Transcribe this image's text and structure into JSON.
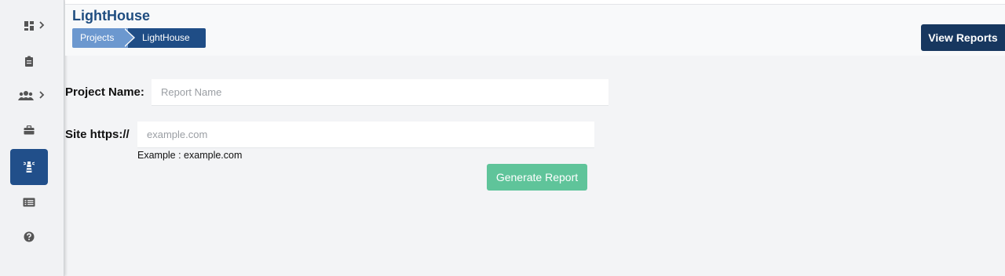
{
  "sidebar": {
    "items": [
      {
        "icon": "dashboard-icon",
        "has_submenu": true
      },
      {
        "icon": "clipboard-icon",
        "has_submenu": false
      },
      {
        "icon": "users-icon",
        "has_submenu": true
      },
      {
        "icon": "briefcase-icon",
        "has_submenu": false
      },
      {
        "icon": "lighthouse-icon",
        "has_submenu": false,
        "active": true
      },
      {
        "icon": "list-icon",
        "has_submenu": false
      },
      {
        "icon": "help-icon",
        "has_submenu": false
      }
    ]
  },
  "header": {
    "title": "LightHouse",
    "breadcrumb": [
      "Projects",
      "LightHouse"
    ],
    "view_reports_label": "View Reports"
  },
  "form": {
    "project_name_label": "Project Name:",
    "project_name_placeholder": "Report Name",
    "site_label": "Site https://",
    "site_placeholder": "example.com",
    "site_hint": "Example : example.com",
    "generate_label": "Generate Report"
  },
  "colors": {
    "sidebar_active": "#214f8a",
    "title": "#1f4d80",
    "breadcrumb_first": "#6c98cf",
    "breadcrumb_current": "#1f4d86",
    "view_reports_bg": "#17375f",
    "generate_bg": "#5fc49a",
    "icon_gray": "#555555"
  }
}
